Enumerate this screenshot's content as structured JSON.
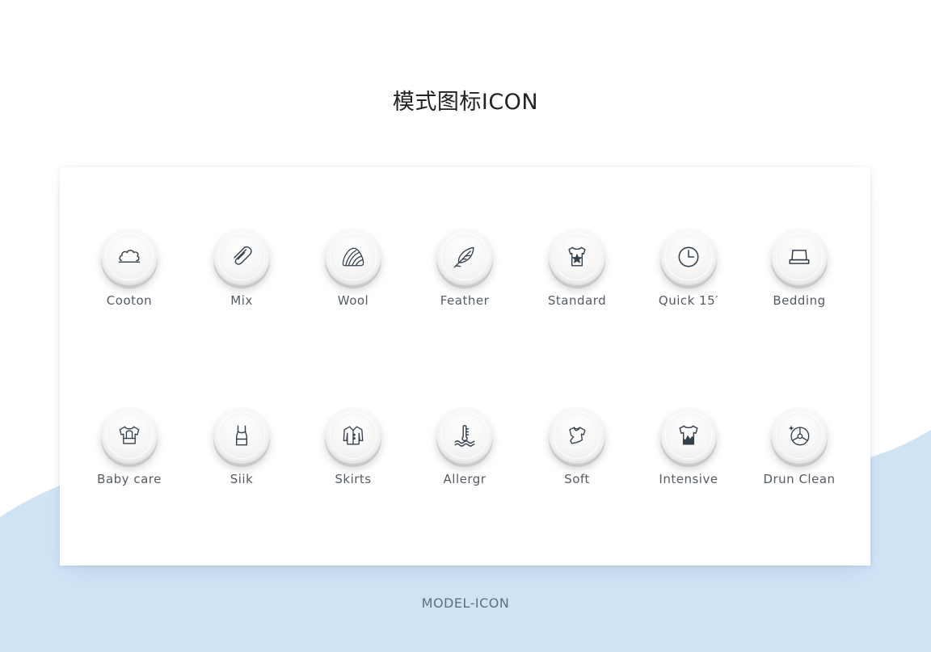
{
  "title": "模式图标ICON",
  "footer": "MODEL-ICON",
  "colors": {
    "background": "#ffffff",
    "wave": "#cfe3f5",
    "icon_stroke": "#34404c",
    "label": "#555b63"
  },
  "rows": [
    [
      {
        "label": "Cooton",
        "icon": "cotton-icon"
      },
      {
        "label": "Mix",
        "icon": "paperclip-icon"
      },
      {
        "label": "Wool",
        "icon": "yarn-ball-icon"
      },
      {
        "label": "Feather",
        "icon": "feather-icon"
      },
      {
        "label": "Standard",
        "icon": "shirt-star-icon"
      },
      {
        "label": "Quick 15′",
        "icon": "clock-icon"
      },
      {
        "label": "Bedding",
        "icon": "bed-icon"
      }
    ],
    [
      {
        "label": "Baby care",
        "icon": "baby-clothes-icon"
      },
      {
        "label": "Siik",
        "icon": "tank-top-icon"
      },
      {
        "label": "Skirts",
        "icon": "dress-shirt-icon"
      },
      {
        "label": "Allergr",
        "icon": "thermometer-icon"
      },
      {
        "label": "Soft",
        "icon": "soft-cloth-icon"
      },
      {
        "label": "Intensive",
        "icon": "stained-shirt-icon"
      },
      {
        "label": "Drun Clean",
        "icon": "drum-clean-icon"
      }
    ]
  ]
}
